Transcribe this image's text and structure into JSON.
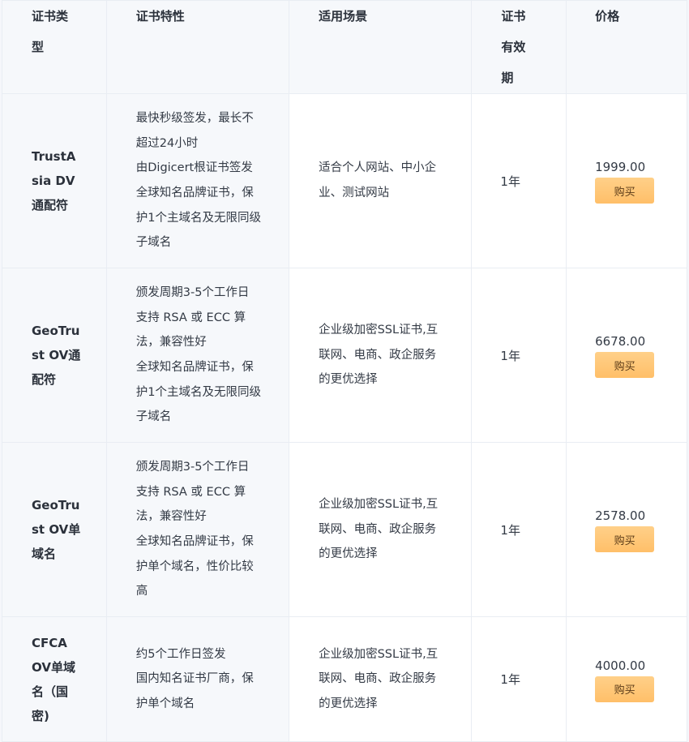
{
  "headers": {
    "type": "证书类型",
    "features": "证书特性",
    "scene": "适用场景",
    "validity": "证书有效期",
    "price": "价格"
  },
  "rows": [
    {
      "type": "TrustAsia DV通配符",
      "features": [
        "最快秒级签发，最长不超过24小时",
        "由Digicert根证书签发",
        "全球知名品牌证书，保护1个主域名及无限同级子域名"
      ],
      "scene": "适合个人网站、中小企业、测试网站",
      "validity": "1年",
      "price": "1999.00",
      "buy": "购买"
    },
    {
      "type": "GeoTrust OV通配符",
      "features": [
        "颁发周期3-5个工作日",
        "支持 RSA 或 ECC 算法，兼容性好",
        "全球知名品牌证书，保护1个主域名及无限同级子域名"
      ],
      "scene": "企业级加密SSL证书,互联网、电商、政企服务的更优选择",
      "validity": "1年",
      "price": "6678.00",
      "buy": "购买"
    },
    {
      "type": "GeoTrust OV单域名",
      "features": [
        "颁发周期3-5个工作日",
        "支持 RSA 或 ECC 算法，兼容性好",
        "全球知名品牌证书，保护单个域名，性价比较高"
      ],
      "scene": "企业级加密SSL证书,互联网、电商、政企服务的更优选择",
      "validity": "1年",
      "price": "2578.00",
      "buy": "购买"
    },
    {
      "type": "CFCA OV单域名（国密)",
      "features": [
        "约5个工作日签发",
        "国内知名证书厂商，保护单个域名"
      ],
      "scene": "企业级加密SSL证书,互联网、电商、政企服务的更优选择",
      "validity": "1年",
      "price": "4000.00",
      "buy": "购买"
    }
  ]
}
